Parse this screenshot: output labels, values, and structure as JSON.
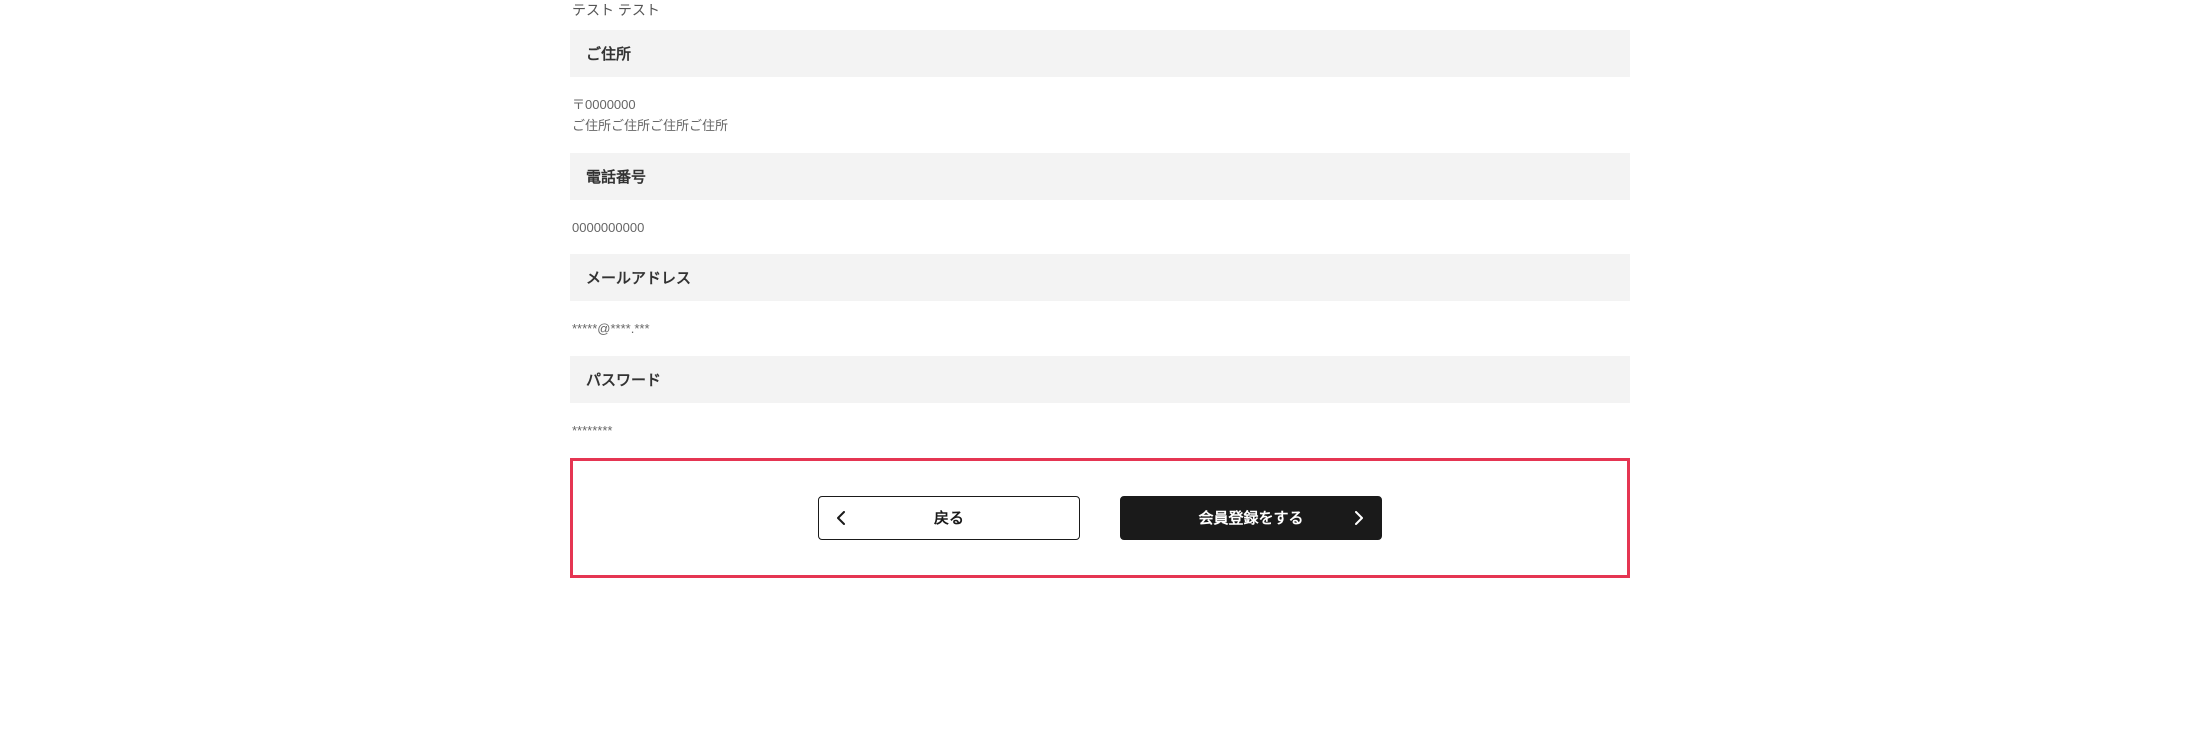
{
  "topValue": "テスト テスト",
  "sections": {
    "address": {
      "label": "ご住所",
      "postal": "〒0000000",
      "value": "ご住所ご住所ご住所ご住所"
    },
    "phone": {
      "label": "電話番号",
      "value": "0000000000"
    },
    "email": {
      "label": "メールアドレス",
      "value": "*****@****.***"
    },
    "password": {
      "label": "パスワード",
      "value": "********"
    }
  },
  "buttons": {
    "back": "戻る",
    "submit": "会員登録をする"
  }
}
